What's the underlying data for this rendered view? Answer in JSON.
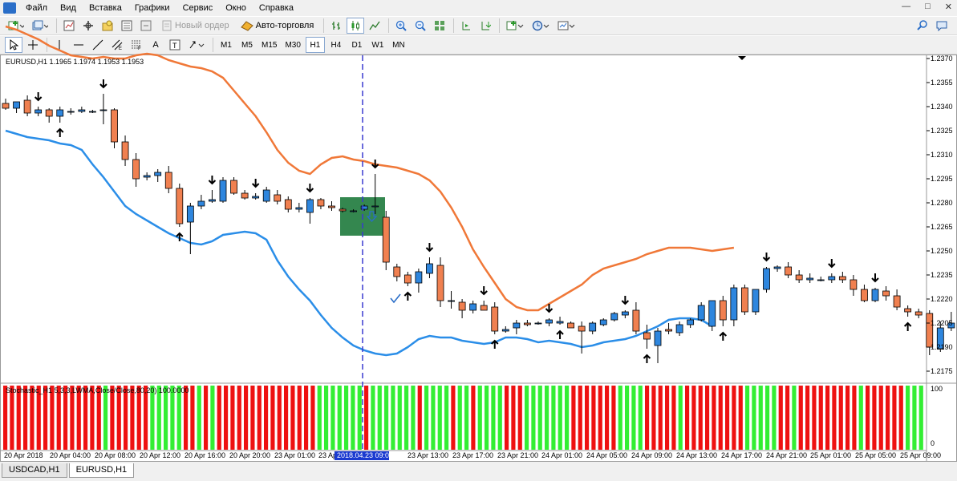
{
  "menu": {
    "items": [
      "Файл",
      "Вид",
      "Вставка",
      "Графики",
      "Сервис",
      "Окно",
      "Справка"
    ],
    "window_controls": [
      "—",
      "□",
      "✕"
    ]
  },
  "toolbar1": {
    "new_order_label": "Новый ордер",
    "autotrade_label": "Авто-торговля"
  },
  "toolbar2": {
    "timeframes": [
      "M1",
      "M5",
      "M15",
      "M30",
      "H1",
      "H4",
      "D1",
      "W1",
      "MN"
    ],
    "active_timeframe": "H1",
    "text_tool_label": "A",
    "label_tool_label": "T"
  },
  "chart": {
    "symbol_info": "EURUSD,H1  1.1965 1.1974 1.1953 1.1953",
    "price_axis": [
      "1.2370",
      "1.2355",
      "1.2340",
      "1.2325",
      "1.2310",
      "1.2295",
      "1.2280",
      "1.2265",
      "1.2250",
      "1.2235",
      "1.2220",
      "1.2205",
      "1.2190",
      "1.2175"
    ],
    "time_axis": [
      "20 Apr 2018",
      "20 Apr 04:00",
      "20 Apr 08:00",
      "20 Apr 12:00",
      "20 Apr 16:00",
      "20 Apr 20:00",
      "23 Apr 01:00",
      "23 Apr",
      "23 Apr 13:00",
      "23 Apr 17:00",
      "23 Apr 21:00",
      "24 Apr 01:00",
      "24 Apr 05:00",
      "24 Apr 09:00",
      "24 Apr 13:00",
      "24 Apr 17:00",
      "24 Apr 21:00",
      "25 Apr 01:00",
      "25 Apr 05:00",
      "25 Apr 09:00"
    ],
    "cursor_time_label": "2018.04.23 09:00",
    "colors": {
      "bull": "#2e86de",
      "bear": "#f08050",
      "upper_band": "#f07838",
      "lower_band": "#2b8ee8",
      "cursor_line": "#3a3ad0",
      "highlight": "#1e7a3c"
    }
  },
  "indicator": {
    "label": "Stochastic_H1 5,3,3,LWMA,Close/Close,80,20) 100.0000",
    "scale_max": "100",
    "scale_min": "0",
    "colors": {
      "up": "#33ee33",
      "down": "#ee1111"
    }
  },
  "tabs": [
    {
      "label": "USDCAD,H1"
    },
    {
      "label": "EURUSD,H1"
    }
  ],
  "chart_data": {
    "type": "candlestick",
    "symbol": "EURUSD",
    "timeframe": "H1",
    "ylim": [
      1.2168,
      1.2372
    ],
    "candles": [
      {
        "o": 1.2342,
        "h": 1.2345,
        "l": 1.2338,
        "c": 1.2339
      },
      {
        "o": 1.2339,
        "h": 1.2343,
        "l": 1.2336,
        "c": 1.2343
      },
      {
        "o": 1.2344,
        "h": 1.2347,
        "l": 1.2334,
        "c": 1.2336
      },
      {
        "o": 1.2336,
        "h": 1.234,
        "l": 1.2334,
        "c": 1.2338
      },
      {
        "o": 1.2338,
        "h": 1.2339,
        "l": 1.233,
        "c": 1.2334
      },
      {
        "o": 1.2334,
        "h": 1.234,
        "l": 1.233,
        "c": 1.2338
      },
      {
        "o": 1.2337,
        "h": 1.2339,
        "l": 1.2335,
        "c": 1.2337
      },
      {
        "o": 1.2337,
        "h": 1.234,
        "l": 1.2336,
        "c": 1.2338
      },
      {
        "o": 1.2337,
        "h": 1.2338,
        "l": 1.2336,
        "c": 1.2337
      },
      {
        "o": 1.2338,
        "h": 1.2348,
        "l": 1.2329,
        "c": 1.2338
      },
      {
        "o": 1.2338,
        "h": 1.2339,
        "l": 1.2314,
        "c": 1.2318
      },
      {
        "o": 1.2318,
        "h": 1.2322,
        "l": 1.2303,
        "c": 1.2307
      },
      {
        "o": 1.2307,
        "h": 1.2311,
        "l": 1.229,
        "c": 1.2295
      },
      {
        "o": 1.2296,
        "h": 1.2299,
        "l": 1.2294,
        "c": 1.2297
      },
      {
        "o": 1.2297,
        "h": 1.2301,
        "l": 1.2293,
        "c": 1.2299
      },
      {
        "o": 1.2299,
        "h": 1.2303,
        "l": 1.2286,
        "c": 1.2289
      },
      {
        "o": 1.2289,
        "h": 1.2292,
        "l": 1.2265,
        "c": 1.2267
      },
      {
        "o": 1.2268,
        "h": 1.228,
        "l": 1.2248,
        "c": 1.2278
      },
      {
        "o": 1.2278,
        "h": 1.2285,
        "l": 1.2276,
        "c": 1.2281
      },
      {
        "o": 1.2281,
        "h": 1.2288,
        "l": 1.228,
        "c": 1.2282
      },
      {
        "o": 1.2281,
        "h": 1.2296,
        "l": 1.228,
        "c": 1.2294
      },
      {
        "o": 1.2294,
        "h": 1.2296,
        "l": 1.2285,
        "c": 1.2286
      },
      {
        "o": 1.2286,
        "h": 1.2288,
        "l": 1.2282,
        "c": 1.2283
      },
      {
        "o": 1.2283,
        "h": 1.2286,
        "l": 1.2282,
        "c": 1.2284
      },
      {
        "o": 1.2281,
        "h": 1.229,
        "l": 1.228,
        "c": 1.2288
      },
      {
        "o": 1.2285,
        "h": 1.2288,
        "l": 1.2279,
        "c": 1.2281
      },
      {
        "o": 1.2282,
        "h": 1.2284,
        "l": 1.2274,
        "c": 1.2276
      },
      {
        "o": 1.2276,
        "h": 1.228,
        "l": 1.2274,
        "c": 1.2277
      },
      {
        "o": 1.2274,
        "h": 1.2283,
        "l": 1.2267,
        "c": 1.2282
      },
      {
        "o": 1.2282,
        "h": 1.2283,
        "l": 1.2276,
        "c": 1.2278
      },
      {
        "o": 1.2278,
        "h": 1.2281,
        "l": 1.2275,
        "c": 1.2277
      },
      {
        "o": 1.2276,
        "h": 1.2277,
        "l": 1.2274,
        "c": 1.2275
      },
      {
        "o": 1.2275,
        "h": 1.2276,
        "l": 1.2274,
        "c": 1.2275
      },
      {
        "o": 1.2276,
        "h": 1.2279,
        "l": 1.2275,
        "c": 1.2278
      },
      {
        "o": 1.2278,
        "h": 1.2298,
        "l": 1.2273,
        "c": 1.2278
      },
      {
        "o": 1.2271,
        "h": 1.2275,
        "l": 1.2238,
        "c": 1.2243
      },
      {
        "o": 1.224,
        "h": 1.2242,
        "l": 1.2231,
        "c": 1.2234
      },
      {
        "o": 1.2235,
        "h": 1.2237,
        "l": 1.2228,
        "c": 1.223
      },
      {
        "o": 1.223,
        "h": 1.2239,
        "l": 1.2224,
        "c": 1.2237
      },
      {
        "o": 1.2236,
        "h": 1.2246,
        "l": 1.2233,
        "c": 1.2242
      },
      {
        "o": 1.2241,
        "h": 1.2246,
        "l": 1.2215,
        "c": 1.2219
      },
      {
        "o": 1.2219,
        "h": 1.2225,
        "l": 1.2214,
        "c": 1.2219
      },
      {
        "o": 1.2218,
        "h": 1.222,
        "l": 1.2208,
        "c": 1.2213
      },
      {
        "o": 1.2213,
        "h": 1.2219,
        "l": 1.2211,
        "c": 1.2217
      },
      {
        "o": 1.2216,
        "h": 1.2219,
        "l": 1.2213,
        "c": 1.2213
      },
      {
        "o": 1.2215,
        "h": 1.2218,
        "l": 1.2198,
        "c": 1.22
      },
      {
        "o": 1.22,
        "h": 1.2203,
        "l": 1.2199,
        "c": 1.2201
      },
      {
        "o": 1.2202,
        "h": 1.2207,
        "l": 1.2198,
        "c": 1.2205
      },
      {
        "o": 1.2205,
        "h": 1.2207,
        "l": 1.2203,
        "c": 1.2204
      },
      {
        "o": 1.2205,
        "h": 1.2206,
        "l": 1.2204,
        "c": 1.2205
      },
      {
        "o": 1.2205,
        "h": 1.2208,
        "l": 1.2203,
        "c": 1.2207
      },
      {
        "o": 1.2205,
        "h": 1.2209,
        "l": 1.2204,
        "c": 1.2206
      },
      {
        "o": 1.2205,
        "h": 1.2206,
        "l": 1.2203,
        "c": 1.2202
      },
      {
        "o": 1.2203,
        "h": 1.2206,
        "l": 1.2186,
        "c": 1.22
      },
      {
        "o": 1.22,
        "h": 1.2206,
        "l": 1.2198,
        "c": 1.2205
      },
      {
        "o": 1.2204,
        "h": 1.2208,
        "l": 1.2203,
        "c": 1.2207
      },
      {
        "o": 1.2207,
        "h": 1.2212,
        "l": 1.2206,
        "c": 1.2211
      },
      {
        "o": 1.221,
        "h": 1.2213,
        "l": 1.2208,
        "c": 1.2212
      },
      {
        "o": 1.2213,
        "h": 1.2218,
        "l": 1.2198,
        "c": 1.22
      },
      {
        "o": 1.2199,
        "h": 1.2204,
        "l": 1.2189,
        "c": 1.2195
      },
      {
        "o": 1.2191,
        "h": 1.2202,
        "l": 1.218,
        "c": 1.22
      },
      {
        "o": 1.2201,
        "h": 1.2205,
        "l": 1.2198,
        "c": 1.22
      },
      {
        "o": 1.2199,
        "h": 1.2206,
        "l": 1.2197,
        "c": 1.2204
      },
      {
        "o": 1.2204,
        "h": 1.2208,
        "l": 1.2202,
        "c": 1.2207
      },
      {
        "o": 1.2207,
        "h": 1.2218,
        "l": 1.2206,
        "c": 1.2216
      },
      {
        "o": 1.2203,
        "h": 1.2219,
        "l": 1.22,
        "c": 1.2219
      },
      {
        "o": 1.2219,
        "h": 1.2222,
        "l": 1.2203,
        "c": 1.2207
      },
      {
        "o": 1.2207,
        "h": 1.2229,
        "l": 1.2203,
        "c": 1.2227
      },
      {
        "o": 1.2227,
        "h": 1.2229,
        "l": 1.221,
        "c": 1.2212
      },
      {
        "o": 1.2212,
        "h": 1.2226,
        "l": 1.221,
        "c": 1.2226
      },
      {
        "o": 1.2226,
        "h": 1.224,
        "l": 1.2224,
        "c": 1.2239
      },
      {
        "o": 1.2239,
        "h": 1.2241,
        "l": 1.2237,
        "c": 1.224
      },
      {
        "o": 1.224,
        "h": 1.2243,
        "l": 1.2233,
        "c": 1.2235
      },
      {
        "o": 1.2235,
        "h": 1.2238,
        "l": 1.223,
        "c": 1.2232
      },
      {
        "o": 1.2232,
        "h": 1.2236,
        "l": 1.223,
        "c": 1.2233
      },
      {
        "o": 1.2232,
        "h": 1.2234,
        "l": 1.2231,
        "c": 1.2232
      },
      {
        "o": 1.2232,
        "h": 1.2236,
        "l": 1.223,
        "c": 1.2234
      },
      {
        "o": 1.2234,
        "h": 1.2237,
        "l": 1.223,
        "c": 1.2232
      },
      {
        "o": 1.2232,
        "h": 1.2235,
        "l": 1.2222,
        "c": 1.2226
      },
      {
        "o": 1.2226,
        "h": 1.2229,
        "l": 1.2218,
        "c": 1.2219
      },
      {
        "o": 1.2219,
        "h": 1.2227,
        "l": 1.2218,
        "c": 1.2226
      },
      {
        "o": 1.2225,
        "h": 1.2228,
        "l": 1.2219,
        "c": 1.2222
      },
      {
        "o": 1.2222,
        "h": 1.2226,
        "l": 1.2213,
        "c": 1.2215
      },
      {
        "o": 1.2214,
        "h": 1.2216,
        "l": 1.2209,
        "c": 1.2212
      },
      {
        "o": 1.2212,
        "h": 1.2214,
        "l": 1.2208,
        "c": 1.221
      },
      {
        "o": 1.2211,
        "h": 1.2213,
        "l": 1.2185,
        "c": 1.219
      },
      {
        "o": 1.2189,
        "h": 1.2206,
        "l": 1.2187,
        "c": 1.2202
      },
      {
        "o": 1.2202,
        "h": 1.2212,
        "l": 1.22,
        "c": 1.2205
      }
    ],
    "upper_band": [
      1.239,
      1.2388,
      1.2385,
      1.2382,
      1.2378,
      1.2375,
      1.2372,
      1.2371,
      1.237,
      1.2371,
      1.237,
      1.237,
      1.2372,
      1.2373,
      1.2372,
      1.2369,
      1.2367,
      1.2365,
      1.2364,
      1.2362,
      1.2358,
      1.235,
      1.2342,
      1.2334,
      1.2324,
      1.2313,
      1.2305,
      1.23,
      1.2298,
      1.2304,
      1.2308,
      1.2309,
      1.2307,
      1.2306,
      1.2304,
      1.2303,
      1.2302,
      1.23,
      1.2298,
      1.2294,
      1.2287,
      1.2277,
      1.2265,
      1.2251,
      1.224,
      1.223,
      1.222,
      1.2215,
      1.2213,
      1.2213,
      1.2217,
      1.2221,
      1.2225,
      1.2229,
      1.2235,
      1.2239,
      1.2241,
      1.2243,
      1.2245,
      1.2248,
      1.225,
      1.2252,
      1.2252,
      1.2252,
      1.2251,
      1.225,
      1.2251,
      1.2252
    ],
    "lower_band": [
      1.2325,
      1.2323,
      1.2321,
      1.232,
      1.2319,
      1.2317,
      1.2316,
      1.2313,
      1.2304,
      1.2296,
      1.2287,
      1.2278,
      1.2273,
      1.2269,
      1.2265,
      1.2261,
      1.2258,
      1.2255,
      1.2254,
      1.2256,
      1.226,
      1.2261,
      1.2262,
      1.2261,
      1.2257,
      1.2244,
      1.2234,
      1.2226,
      1.2219,
      1.221,
      1.2202,
      1.2196,
      1.2191,
      1.2188,
      1.2186,
      1.2185,
      1.2186,
      1.219,
      1.2195,
      1.2197,
      1.2196,
      1.2196,
      1.2194,
      1.2193,
      1.2192,
      1.2193,
      1.2196,
      1.2196,
      1.2195,
      1.2193,
      1.2194,
      1.2193,
      1.2192,
      1.219,
      1.2191,
      1.2193,
      1.2194,
      1.2195,
      1.2197,
      1.22,
      1.2203,
      1.2207,
      1.2208,
      1.2208,
      1.2207,
      1.2203
    ],
    "stochastic_colors": "RRRRRRRRRRRRRRRGRRRRRRGGGGGRRGRGRRRRRRRRRRRRRRRGGGGGGGRGGGGGGGRGGGGRGGRGGGGRRRGGGGGGGRRRRRRRGGGGRRRRRGRRRRRRRRRGGGGGRRGRRRRRRRRRGRRRRRRGGG"
  }
}
